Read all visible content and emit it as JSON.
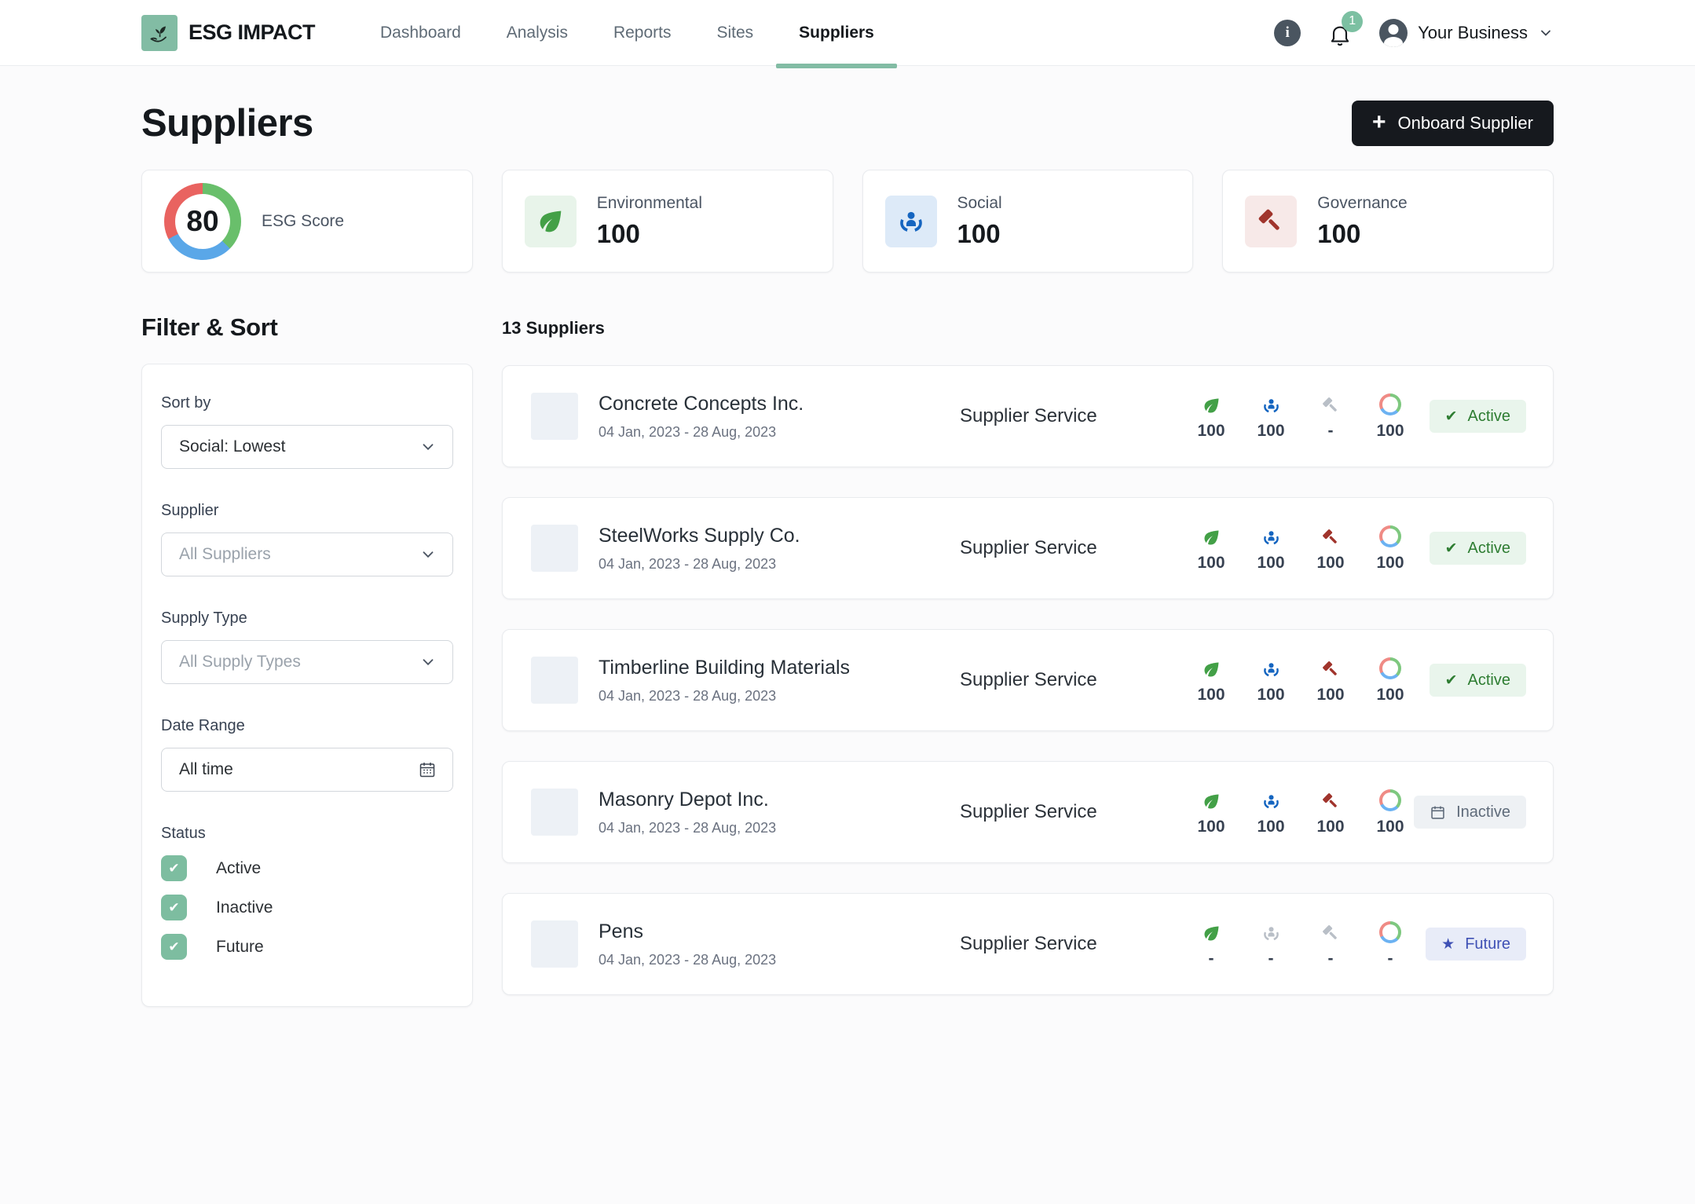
{
  "brand": {
    "name": "ESG IMPACT"
  },
  "nav": {
    "items": [
      {
        "label": "Dashboard",
        "active": false
      },
      {
        "label": "Analysis",
        "active": false
      },
      {
        "label": "Reports",
        "active": false
      },
      {
        "label": "Sites",
        "active": false
      },
      {
        "label": "Suppliers",
        "active": true
      }
    ],
    "notification_count": "1",
    "account_label": "Your Business"
  },
  "page": {
    "title": "Suppliers",
    "onboard_button_label": "Onboard Supplier"
  },
  "stats": {
    "esg_score": {
      "label": "ESG Score",
      "value": "80"
    },
    "cards": [
      {
        "label": "Environmental",
        "value": "100",
        "icon": "leaf-icon",
        "theme": "env"
      },
      {
        "label": "Social",
        "value": "100",
        "icon": "social-icon",
        "theme": "social"
      },
      {
        "label": "Governance",
        "value": "100",
        "icon": "gavel-icon",
        "theme": "gov"
      }
    ]
  },
  "filters": {
    "heading": "Filter & Sort",
    "groups": {
      "sort_by": {
        "label": "Sort by",
        "value": "Social: Lowest"
      },
      "supplier": {
        "label": "Supplier",
        "value": "All Suppliers"
      },
      "supply_type": {
        "label": "Supply Type",
        "value": "All Supply Types"
      },
      "date_range": {
        "label": "Date Range",
        "value": "All time"
      }
    },
    "status": {
      "label": "Status",
      "options": [
        {
          "label": "Active",
          "checked": true
        },
        {
          "label": "Inactive",
          "checked": true
        },
        {
          "label": "Future",
          "checked": true
        }
      ]
    }
  },
  "supplier_list": {
    "count_label": "13 Suppliers",
    "rows": [
      {
        "name": "Concrete Concepts Inc.",
        "date_range": "04 Jan, 2023 - 28 Aug, 2023",
        "service_type": "Supplier Service",
        "scores": {
          "environmental": "100",
          "social": "100",
          "governance": "-",
          "esg": "100"
        },
        "score_active": {
          "environmental": true,
          "social": true,
          "governance": false
        },
        "status": "Active"
      },
      {
        "name": "SteelWorks Supply Co.",
        "date_range": "04 Jan, 2023 - 28 Aug, 2023",
        "service_type": "Supplier Service",
        "scores": {
          "environmental": "100",
          "social": "100",
          "governance": "100",
          "esg": "100"
        },
        "score_active": {
          "environmental": true,
          "social": true,
          "governance": true
        },
        "status": "Active"
      },
      {
        "name": "Timberline Building Materials",
        "date_range": "04 Jan, 2023 - 28 Aug, 2023",
        "service_type": "Supplier Service",
        "scores": {
          "environmental": "100",
          "social": "100",
          "governance": "100",
          "esg": "100"
        },
        "score_active": {
          "environmental": true,
          "social": true,
          "governance": true
        },
        "status": "Active"
      },
      {
        "name": "Masonry Depot Inc.",
        "date_range": "04 Jan, 2023 - 28 Aug, 2023",
        "service_type": "Supplier Service",
        "scores": {
          "environmental": "100",
          "social": "100",
          "governance": "100",
          "esg": "100"
        },
        "score_active": {
          "environmental": true,
          "social": true,
          "governance": true
        },
        "status": "Inactive"
      },
      {
        "name": "Pens",
        "date_range": "04 Jan, 2023 - 28 Aug, 2023",
        "service_type": "Supplier Service",
        "scores": {
          "environmental": "-",
          "social": "-",
          "governance": "-",
          "esg": "-"
        },
        "score_active": {
          "environmental": true,
          "social": false,
          "governance": false
        },
        "status": "Future"
      }
    ]
  },
  "colors": {
    "accent_green": "#82bca4",
    "leaf_green": "#43a047",
    "social_blue": "#1565c0",
    "governance_red": "#a0342c",
    "ring_green": "#69bf6b",
    "ring_blue": "#5aa7e8",
    "ring_red": "#e96360",
    "active_text": "#2e7d32",
    "future_text": "#3f51b5",
    "inactive_text": "#5f6b7a"
  },
  "icons": {
    "plus": "+",
    "check": "✔",
    "star": "★",
    "info": "i"
  }
}
